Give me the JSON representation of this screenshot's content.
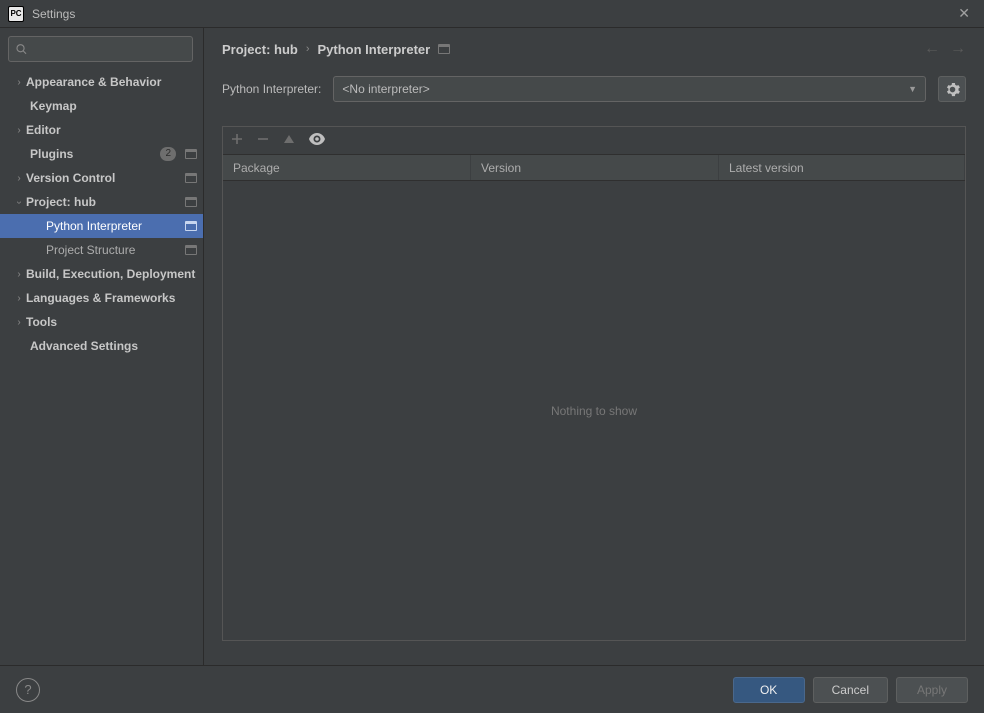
{
  "window": {
    "title": "Settings",
    "app_icon_text": "PC"
  },
  "search": {
    "placeholder": ""
  },
  "sidebar": {
    "items": [
      {
        "label": "Appearance & Behavior"
      },
      {
        "label": "Keymap"
      },
      {
        "label": "Editor"
      },
      {
        "label": "Plugins",
        "badge_count": "2"
      },
      {
        "label": "Version Control"
      },
      {
        "label": "Project: hub"
      },
      {
        "label": "Python Interpreter"
      },
      {
        "label": "Project Structure"
      },
      {
        "label": "Build, Execution, Deployment"
      },
      {
        "label": "Languages & Frameworks"
      },
      {
        "label": "Tools"
      },
      {
        "label": "Advanced Settings"
      }
    ]
  },
  "breadcrumb": {
    "crumb0": "Project: hub",
    "crumb1": "Python Interpreter"
  },
  "interpreter": {
    "label": "Python Interpreter:",
    "value": "<No interpreter>"
  },
  "packages": {
    "col_package": "Package",
    "col_version": "Version",
    "col_latest": "Latest version",
    "empty_text": "Nothing to show"
  },
  "buttons": {
    "ok": "OK",
    "cancel": "Cancel",
    "apply": "Apply"
  }
}
